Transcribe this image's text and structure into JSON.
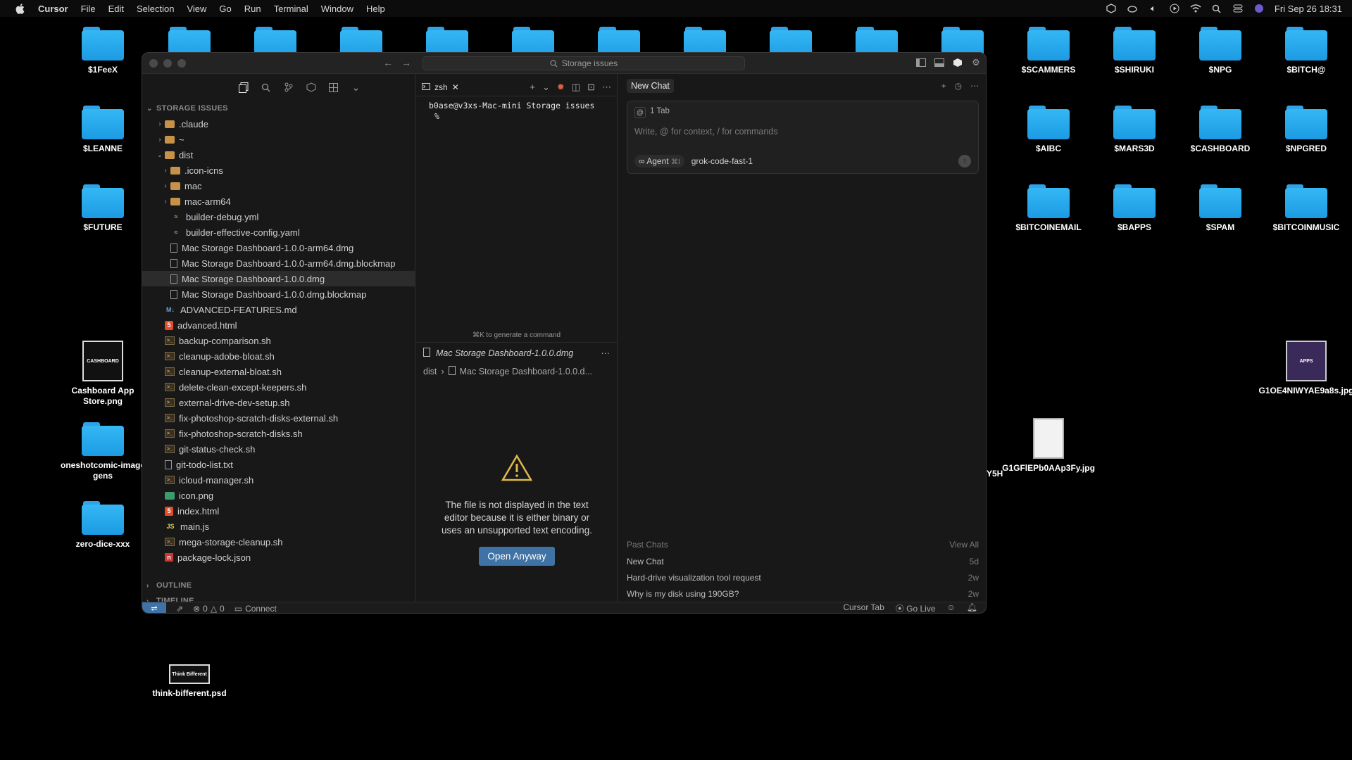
{
  "menubar": {
    "app": "Cursor",
    "items": [
      "File",
      "Edit",
      "Selection",
      "View",
      "Go",
      "Run",
      "Terminal",
      "Window",
      "Help"
    ],
    "clock": "Fri Sep 26  18:31"
  },
  "desktop": {
    "top_row": [
      {
        "label": "$1FeeX"
      },
      {
        "label": "$SCAMMERS"
      },
      {
        "label": "$SHIRUKI"
      },
      {
        "label": "$NPG"
      },
      {
        "label": "$BITCH@"
      }
    ],
    "left_col": [
      {
        "label": "$LEANNE"
      },
      {
        "label": "$FUTURE"
      },
      {
        "label": "Cashboard App Store.png"
      },
      {
        "label": "oneshotcomic-image gens"
      },
      {
        "label": "zero-dice-xxx"
      },
      {
        "label": "think-bifferent.psd"
      }
    ],
    "right_grid": [
      {
        "label": "$AIBC"
      },
      {
        "label": "$MARS3D"
      },
      {
        "label": "$CASHBOARD"
      },
      {
        "label": "$NPGRED"
      },
      {
        "label": "$BITCOINEMAIL"
      },
      {
        "label": "$BAPPS"
      },
      {
        "label": "$SPAM"
      },
      {
        "label": "$BITCOINMUSIC"
      },
      {
        "label": "G1OE4NIWYAE9a8s.jpg"
      },
      {
        "label": "G1GFlEPb0AAp3Fy.jpg"
      },
      {
        "label": "Y5H"
      }
    ],
    "thumb_texts": {
      "cashboard": "CASHBOARD",
      "think": "Think Bifferent",
      "apps": "APPS"
    }
  },
  "window": {
    "search_placeholder": "Storage issues",
    "sidebar": {
      "section_title": "STORAGE ISSUES",
      "outline": "OUTLINE",
      "timeline": "TIMELINE",
      "tree": [
        {
          "name": ".claude",
          "type": "folder",
          "depth": 0,
          "twist": "›"
        },
        {
          "name": "~",
          "type": "folder",
          "depth": 0,
          "twist": "›"
        },
        {
          "name": "dist",
          "type": "folder",
          "depth": 0,
          "twist": "⌄"
        },
        {
          "name": ".icon-icns",
          "type": "folder",
          "depth": 1,
          "twist": "›"
        },
        {
          "name": "mac",
          "type": "folder",
          "depth": 1,
          "twist": "›"
        },
        {
          "name": "mac-arm64",
          "type": "folder",
          "depth": 1,
          "twist": "›"
        },
        {
          "name": "builder-debug.yml",
          "type": "yml",
          "depth": 1,
          "twist": ""
        },
        {
          "name": "builder-effective-config.yaml",
          "type": "yml",
          "depth": 1,
          "twist": ""
        },
        {
          "name": "Mac Storage Dashboard-1.0.0-arm64.dmg",
          "type": "doc",
          "depth": 1,
          "twist": ""
        },
        {
          "name": "Mac Storage Dashboard-1.0.0-arm64.dmg.blockmap",
          "type": "doc",
          "depth": 1,
          "twist": ""
        },
        {
          "name": "Mac Storage Dashboard-1.0.0.dmg",
          "type": "doc",
          "depth": 1,
          "twist": "",
          "selected": true
        },
        {
          "name": "Mac Storage Dashboard-1.0.0.dmg.blockmap",
          "type": "doc",
          "depth": 1,
          "twist": ""
        },
        {
          "name": "ADVANCED-FEATURES.md",
          "type": "md",
          "depth": 0,
          "twist": ""
        },
        {
          "name": "advanced.html",
          "type": "html",
          "depth": 0,
          "twist": ""
        },
        {
          "name": "backup-comparison.sh",
          "type": "sh",
          "depth": 0,
          "twist": ""
        },
        {
          "name": "cleanup-adobe-bloat.sh",
          "type": "sh",
          "depth": 0,
          "twist": ""
        },
        {
          "name": "cleanup-external-bloat.sh",
          "type": "sh",
          "depth": 0,
          "twist": ""
        },
        {
          "name": "delete-clean-except-keepers.sh",
          "type": "sh",
          "depth": 0,
          "twist": ""
        },
        {
          "name": "external-drive-dev-setup.sh",
          "type": "sh",
          "depth": 0,
          "twist": ""
        },
        {
          "name": "fix-photoshop-scratch-disks-external.sh",
          "type": "sh",
          "depth": 0,
          "twist": ""
        },
        {
          "name": "fix-photoshop-scratch-disks.sh",
          "type": "sh",
          "depth": 0,
          "twist": ""
        },
        {
          "name": "git-status-check.sh",
          "type": "sh",
          "depth": 0,
          "twist": ""
        },
        {
          "name": "git-todo-list.txt",
          "type": "txt",
          "depth": 0,
          "twist": ""
        },
        {
          "name": "icloud-manager.sh",
          "type": "sh",
          "depth": 0,
          "twist": ""
        },
        {
          "name": "icon.png",
          "type": "png",
          "depth": 0,
          "twist": ""
        },
        {
          "name": "index.html",
          "type": "html",
          "depth": 0,
          "twist": ""
        },
        {
          "name": "main.js",
          "type": "js",
          "depth": 0,
          "twist": ""
        },
        {
          "name": "mega-storage-cleanup.sh",
          "type": "sh",
          "depth": 0,
          "twist": ""
        },
        {
          "name": "package-lock.json",
          "type": "json",
          "depth": 0,
          "twist": ""
        }
      ]
    },
    "terminal": {
      "tab_label": "zsh",
      "prompt_line": "b0ase@v3xs-Mac-mini Storage issues",
      "prompt_symbol": "%",
      "hint": "⌘K to generate a command"
    },
    "editor": {
      "tab_label": "Mac Storage Dashboard-1.0.0.dmg",
      "crumb_folder": "dist",
      "crumb_file": "Mac Storage Dashboard-1.0.0.d...",
      "message": "The file is not displayed in the text editor because it is either binary or uses an unsupported text encoding.",
      "button": "Open Anyway"
    },
    "chat": {
      "title": "New Chat",
      "ctx_tab": "1 Tab",
      "placeholder": "Write, @ for context, / for commands",
      "agent_label": "Agent",
      "agent_shortcut": "⌘I",
      "model": "grok-code-fast-1",
      "past_header": "Past Chats",
      "view_all": "View All",
      "past": [
        {
          "title": "New Chat",
          "age": "5d"
        },
        {
          "title": "Hard-drive visualization tool request",
          "age": "2w"
        },
        {
          "title": "Why is my disk using 190GB?",
          "age": "2w"
        }
      ]
    },
    "status": {
      "errors": "0",
      "warnings": "0",
      "connect": "Connect",
      "cursor_tab": "Cursor Tab",
      "go_live": "Go Live"
    }
  }
}
